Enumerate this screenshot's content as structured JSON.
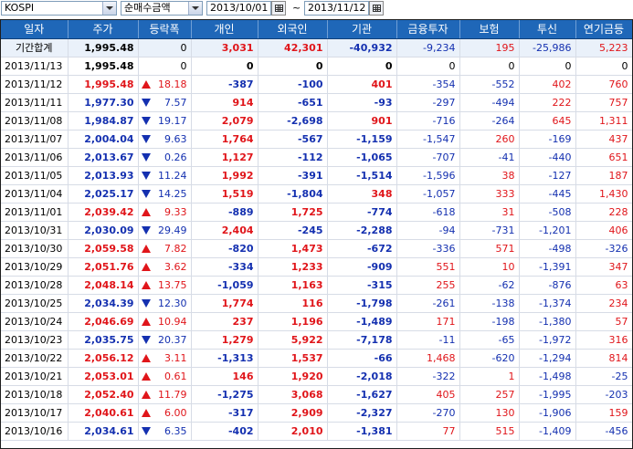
{
  "toolbar": {
    "market": "KOSPI",
    "metric": "순매수금액",
    "start_date": "2013/10/01",
    "separator": "~",
    "end_date": "2013/11/12"
  },
  "columns": [
    "일자",
    "주가",
    "등락폭",
    "개인",
    "외국인",
    "기관",
    "금융투자",
    "보험",
    "투신",
    "연기금등"
  ],
  "rows": [
    {
      "date": "기간합계",
      "price": "1,995.48",
      "dir": "",
      "change": "0",
      "indiv": "3,031",
      "foreign": "42,301",
      "inst": "-40,932",
      "fin": "-9,234",
      "ins": "195",
      "trust": "-25,986",
      "pension": "5,223",
      "total": true
    },
    {
      "date": "2013/11/13",
      "price": "1,995.48",
      "dir": "",
      "change": "0",
      "indiv": "0",
      "foreign": "0",
      "inst": "0",
      "fin": "0",
      "ins": "0",
      "trust": "0",
      "pension": "0"
    },
    {
      "date": "2013/11/12",
      "price": "1,995.48",
      "dir": "up",
      "change": "18.18",
      "indiv": "-387",
      "foreign": "-100",
      "inst": "401",
      "fin": "-354",
      "ins": "-552",
      "trust": "402",
      "pension": "760"
    },
    {
      "date": "2013/11/11",
      "price": "1,977.30",
      "dir": "down",
      "change": "7.57",
      "indiv": "914",
      "foreign": "-651",
      "inst": "-93",
      "fin": "-297",
      "ins": "-494",
      "trust": "222",
      "pension": "757"
    },
    {
      "date": "2013/11/08",
      "price": "1,984.87",
      "dir": "down",
      "change": "19.17",
      "indiv": "2,079",
      "foreign": "-2,698",
      "inst": "901",
      "fin": "-716",
      "ins": "-264",
      "trust": "645",
      "pension": "1,311"
    },
    {
      "date": "2013/11/07",
      "price": "2,004.04",
      "dir": "down",
      "change": "9.63",
      "indiv": "1,764",
      "foreign": "-567",
      "inst": "-1,159",
      "fin": "-1,547",
      "ins": "260",
      "trust": "-169",
      "pension": "437"
    },
    {
      "date": "2013/11/06",
      "price": "2,013.67",
      "dir": "down",
      "change": "0.26",
      "indiv": "1,127",
      "foreign": "-112",
      "inst": "-1,065",
      "fin": "-707",
      "ins": "-41",
      "trust": "-440",
      "pension": "651"
    },
    {
      "date": "2013/11/05",
      "price": "2,013.93",
      "dir": "down",
      "change": "11.24",
      "indiv": "1,992",
      "foreign": "-391",
      "inst": "-1,514",
      "fin": "-1,596",
      "ins": "38",
      "trust": "-127",
      "pension": "187"
    },
    {
      "date": "2013/11/04",
      "price": "2,025.17",
      "dir": "down",
      "change": "14.25",
      "indiv": "1,519",
      "foreign": "-1,804",
      "inst": "348",
      "fin": "-1,057",
      "ins": "333",
      "trust": "-445",
      "pension": "1,430"
    },
    {
      "date": "2013/11/01",
      "price": "2,039.42",
      "dir": "up",
      "change": "9.33",
      "indiv": "-889",
      "foreign": "1,725",
      "inst": "-774",
      "fin": "-618",
      "ins": "31",
      "trust": "-508",
      "pension": "228"
    },
    {
      "date": "2013/10/31",
      "price": "2,030.09",
      "dir": "down",
      "change": "29.49",
      "indiv": "2,404",
      "foreign": "-245",
      "inst": "-2,288",
      "fin": "-94",
      "ins": "-731",
      "trust": "-1,201",
      "pension": "406"
    },
    {
      "date": "2013/10/30",
      "price": "2,059.58",
      "dir": "up",
      "change": "7.82",
      "indiv": "-820",
      "foreign": "1,473",
      "inst": "-672",
      "fin": "-336",
      "ins": "571",
      "trust": "-498",
      "pension": "-326"
    },
    {
      "date": "2013/10/29",
      "price": "2,051.76",
      "dir": "up",
      "change": "3.62",
      "indiv": "-334",
      "foreign": "1,233",
      "inst": "-909",
      "fin": "551",
      "ins": "10",
      "trust": "-1,391",
      "pension": "347"
    },
    {
      "date": "2013/10/28",
      "price": "2,048.14",
      "dir": "up",
      "change": "13.75",
      "indiv": "-1,059",
      "foreign": "1,163",
      "inst": "-315",
      "fin": "255",
      "ins": "-62",
      "trust": "-876",
      "pension": "63"
    },
    {
      "date": "2013/10/25",
      "price": "2,034.39",
      "dir": "down",
      "change": "12.30",
      "indiv": "1,774",
      "foreign": "116",
      "inst": "-1,798",
      "fin": "-261",
      "ins": "-138",
      "trust": "-1,374",
      "pension": "234"
    },
    {
      "date": "2013/10/24",
      "price": "2,046.69",
      "dir": "up",
      "change": "10.94",
      "indiv": "237",
      "foreign": "1,196",
      "inst": "-1,489",
      "fin": "171",
      "ins": "-198",
      "trust": "-1,380",
      "pension": "57"
    },
    {
      "date": "2013/10/23",
      "price": "2,035.75",
      "dir": "down",
      "change": "20.37",
      "indiv": "1,279",
      "foreign": "5,922",
      "inst": "-7,178",
      "fin": "-11",
      "ins": "-65",
      "trust": "-1,972",
      "pension": "316"
    },
    {
      "date": "2013/10/22",
      "price": "2,056.12",
      "dir": "up",
      "change": "3.11",
      "indiv": "-1,313",
      "foreign": "1,537",
      "inst": "-66",
      "fin": "1,468",
      "ins": "-620",
      "trust": "-1,294",
      "pension": "814"
    },
    {
      "date": "2013/10/21",
      "price": "2,053.01",
      "dir": "up",
      "change": "0.61",
      "indiv": "146",
      "foreign": "1,920",
      "inst": "-2,018",
      "fin": "-322",
      "ins": "1",
      "trust": "-1,498",
      "pension": "-25"
    },
    {
      "date": "2013/10/18",
      "price": "2,052.40",
      "dir": "up",
      "change": "11.79",
      "indiv": "-1,275",
      "foreign": "3,068",
      "inst": "-1,627",
      "fin": "405",
      "ins": "257",
      "trust": "-1,995",
      "pension": "-203"
    },
    {
      "date": "2013/10/17",
      "price": "2,040.61",
      "dir": "up",
      "change": "6.00",
      "indiv": "-317",
      "foreign": "2,909",
      "inst": "-2,327",
      "fin": "-270",
      "ins": "130",
      "trust": "-1,906",
      "pension": "159"
    },
    {
      "date": "2013/10/16",
      "price": "2,034.61",
      "dir": "down",
      "change": "6.35",
      "indiv": "-402",
      "foreign": "2,010",
      "inst": "-1,381",
      "fin": "77",
      "ins": "515",
      "trust": "-1,409",
      "pension": "-456"
    }
  ],
  "colors": {
    "header_bg": "#1f67b8",
    "up": "#e0151a",
    "down": "#1430b0"
  },
  "icons": {
    "market_dropdown": "chevron-down-icon",
    "metric_dropdown": "chevron-down-icon",
    "calendar": "calendar-icon"
  }
}
